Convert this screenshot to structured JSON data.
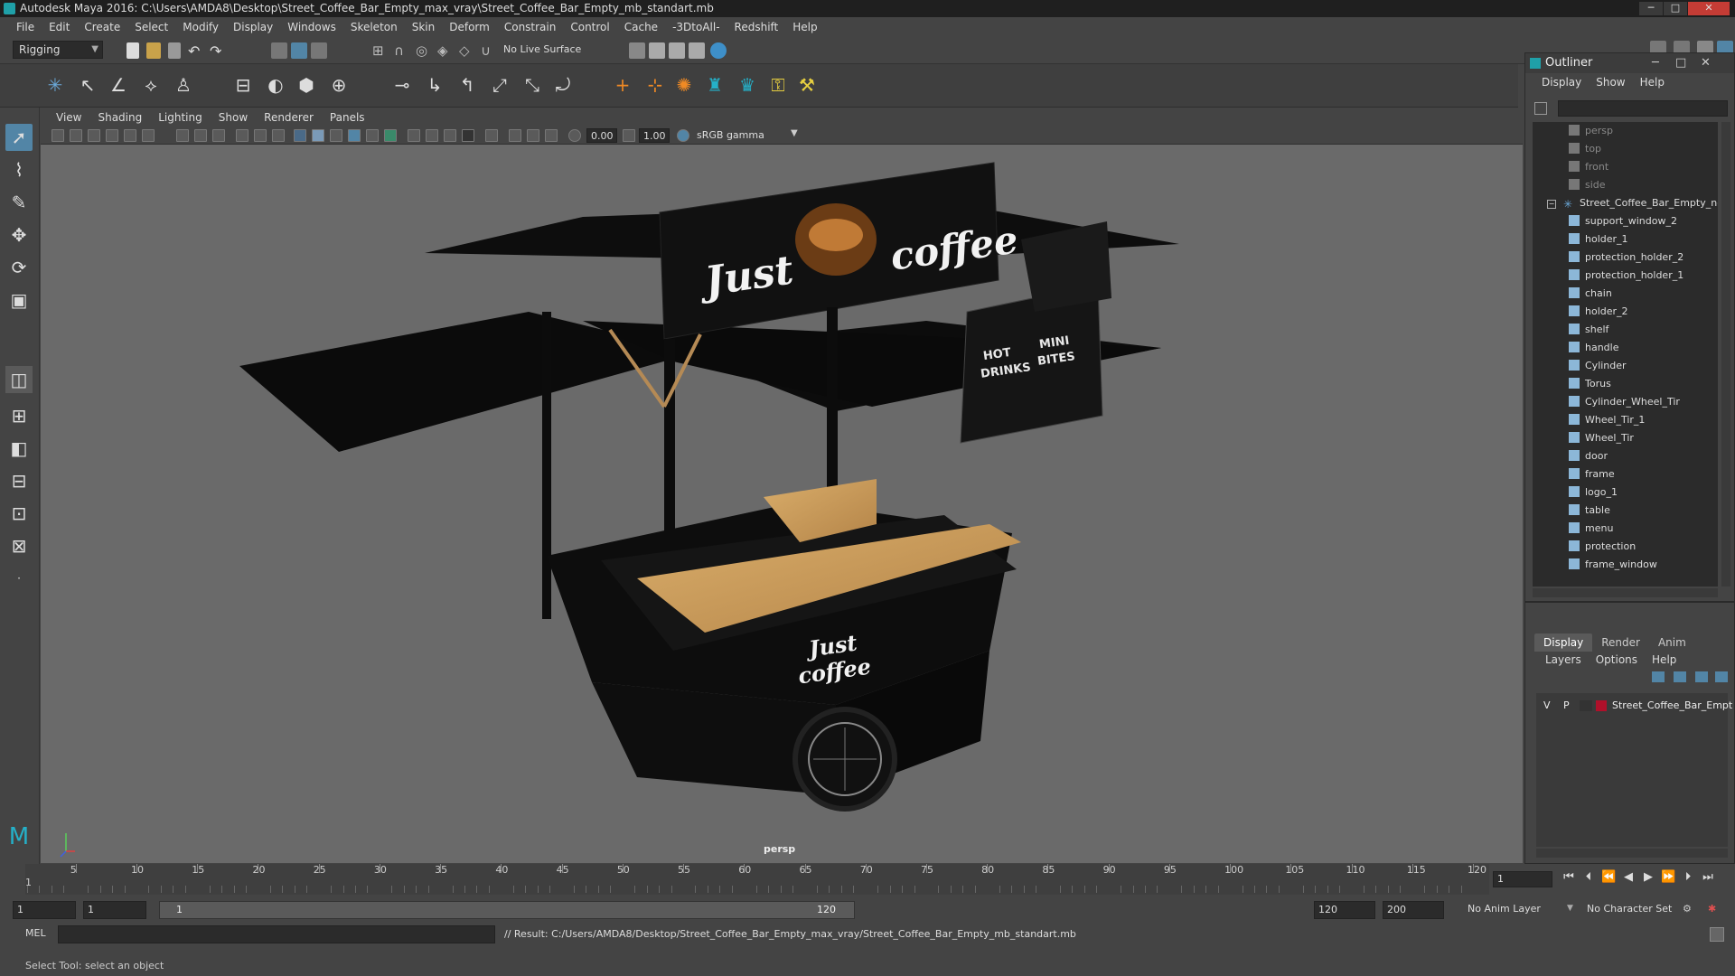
{
  "window": {
    "title": "Autodesk Maya 2016: C:\\Users\\AMDA8\\Desktop\\Street_Coffee_Bar_Empty_max_vray\\Street_Coffee_Bar_Empty_mb_standart.mb",
    "minimize": "─",
    "maximize": "□",
    "close": "✕"
  },
  "menubar": [
    "File",
    "Edit",
    "Create",
    "Select",
    "Modify",
    "Display",
    "Windows",
    "Skeleton",
    "Skin",
    "Deform",
    "Constrain",
    "Control",
    "Cache",
    "-3DtoAll-",
    "Redshift",
    "Help"
  ],
  "statusline": {
    "menuset": "Rigging",
    "live_surface": "No Live Surface"
  },
  "panel": {
    "menus": [
      "View",
      "Shading",
      "Lighting",
      "Show",
      "Renderer",
      "Panels"
    ],
    "exposure": "0.00",
    "gamma": "1.00",
    "color_space": "sRGB gamma",
    "camera_label": "persp"
  },
  "scene": {
    "sign_text_left": "Just",
    "sign_text_right": "coffee",
    "cart_text_1": "Just",
    "cart_text_2": "coffee",
    "board_text_1": "HOT",
    "board_text_2": "DRINKS",
    "board_text_3": "MINI",
    "board_text_4": "BITES"
  },
  "outliner": {
    "title": "Outliner",
    "menus": [
      "Display",
      "Show",
      "Help"
    ],
    "items": [
      {
        "label": "persp",
        "kind": "camera",
        "indent": 0
      },
      {
        "label": "top",
        "kind": "camera",
        "indent": 0
      },
      {
        "label": "front",
        "kind": "camera",
        "indent": 0
      },
      {
        "label": "side",
        "kind": "camera",
        "indent": 0
      },
      {
        "label": "Street_Coffee_Bar_Empty_nc",
        "kind": "group",
        "indent": 0
      },
      {
        "label": "support_window_2",
        "kind": "mesh",
        "indent": 1
      },
      {
        "label": "holder_1",
        "kind": "mesh",
        "indent": 1
      },
      {
        "label": "protection_holder_2",
        "kind": "mesh",
        "indent": 1
      },
      {
        "label": "protection_holder_1",
        "kind": "mesh",
        "indent": 1
      },
      {
        "label": "chain",
        "kind": "mesh",
        "indent": 1
      },
      {
        "label": "holder_2",
        "kind": "mesh",
        "indent": 1
      },
      {
        "label": "shelf",
        "kind": "mesh",
        "indent": 1
      },
      {
        "label": "handle",
        "kind": "mesh",
        "indent": 1
      },
      {
        "label": "Cylinder",
        "kind": "mesh",
        "indent": 1
      },
      {
        "label": "Torus",
        "kind": "mesh",
        "indent": 1
      },
      {
        "label": "Cylinder_Wheel_Tir",
        "kind": "mesh",
        "indent": 1
      },
      {
        "label": "Wheel_Tir_1",
        "kind": "mesh",
        "indent": 1
      },
      {
        "label": "Wheel_Tir",
        "kind": "mesh",
        "indent": 1
      },
      {
        "label": "door",
        "kind": "mesh",
        "indent": 1
      },
      {
        "label": "frame",
        "kind": "mesh",
        "indent": 1
      },
      {
        "label": "logo_1",
        "kind": "mesh",
        "indent": 1
      },
      {
        "label": "table",
        "kind": "mesh",
        "indent": 1
      },
      {
        "label": "menu",
        "kind": "mesh",
        "indent": 1
      },
      {
        "label": "protection",
        "kind": "mesh",
        "indent": 1
      },
      {
        "label": "frame_window",
        "kind": "mesh",
        "indent": 1
      }
    ]
  },
  "layers": {
    "tabs": [
      "Display",
      "Render",
      "Anim"
    ],
    "menus": [
      "Layers",
      "Options",
      "Help"
    ],
    "row": {
      "v": "V",
      "p": "P",
      "name": "Street_Coffee_Bar_Empt",
      "color": "#b0102a"
    }
  },
  "timeline": {
    "ticks": [
      "5",
      "10",
      "15",
      "20",
      "25",
      "30",
      "35",
      "40",
      "45",
      "50",
      "55",
      "60",
      "65",
      "70",
      "75",
      "80",
      "85",
      "90",
      "95",
      "100",
      "105",
      "110",
      "115",
      "120"
    ],
    "first": "1",
    "current": "1"
  },
  "range": {
    "start": "1",
    "start2": "1",
    "slider_start": "1",
    "slider_end": "120",
    "end": "120",
    "max": "200",
    "anim_layer": "No Anim Layer",
    "char_set": "No Character Set"
  },
  "cmdline": {
    "lang": "MEL",
    "result": "// Result: C:/Users/AMDA8/Desktop/Street_Coffee_Bar_Empty_max_vray/Street_Coffee_Bar_Empty_mb_standart.mb"
  },
  "helpline": "Select Tool: select an object",
  "colors": {
    "accent": "#5285a6",
    "viewport": "#6a6a6a",
    "wood": "#c79a5b"
  }
}
